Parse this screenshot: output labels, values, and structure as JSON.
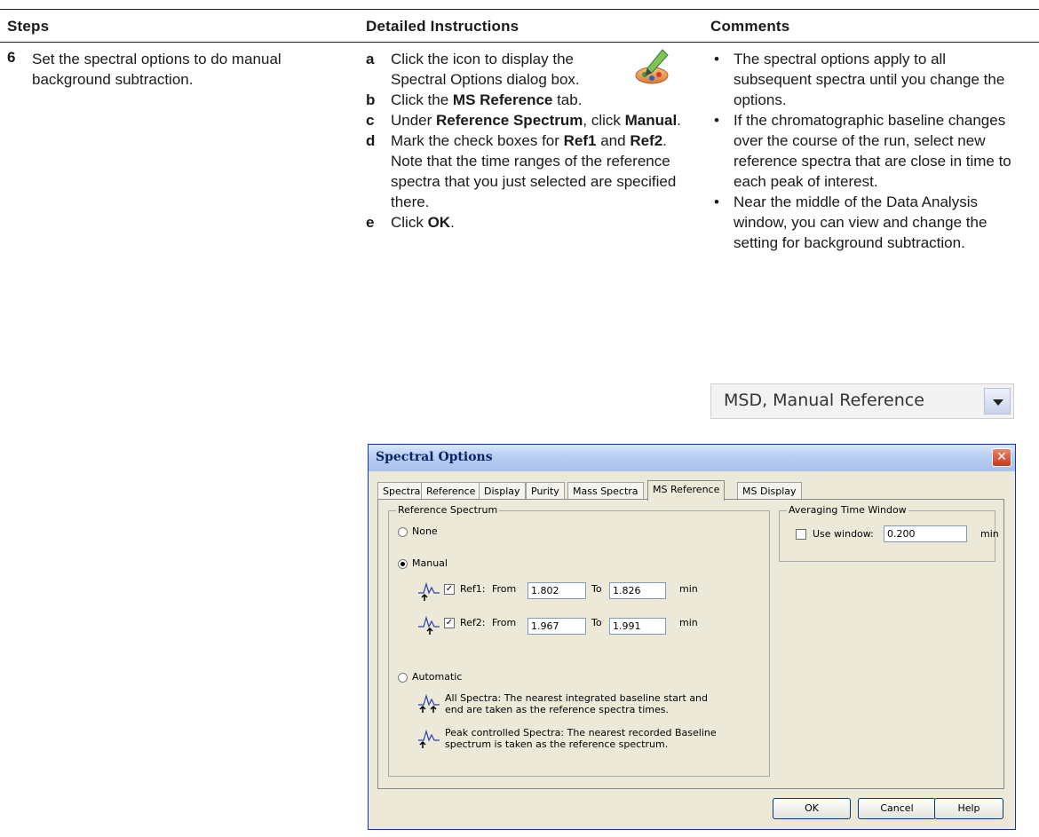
{
  "header": {
    "steps": "Steps",
    "instructions": "Detailed Instructions",
    "comments": "Comments"
  },
  "step": {
    "number": "6",
    "text": "Set the spectral options to do manual background subtraction."
  },
  "instructions": {
    "a": {
      "letter": "a",
      "text": "Click the icon to display the Spectral Options dialog box."
    },
    "b": {
      "letter": "b",
      "pre": "Click the ",
      "bold": "MS Reference",
      "post": " tab."
    },
    "c": {
      "letter": "c",
      "pre": "Under ",
      "bold": "Reference Spectrum",
      "mid": ", click ",
      "bold2": "Manual",
      "post": "."
    },
    "d": {
      "letter": "d",
      "pre": "Mark the check boxes for ",
      "bold": "Ref1",
      "mid": " and ",
      "bold2": "Ref2",
      "post": ". Note that the time ranges of the reference spectra that you just selected are specified there."
    },
    "e": {
      "letter": "e",
      "pre": "Click ",
      "bold": "OK",
      "post": "."
    }
  },
  "comments": [
    "The spectral options apply to all subsequent spectra until you change the options.",
    "If the chromatographic baseline changes over the course of the run, select new reference spectra that are close in time to each peak of interest.",
    "Near the middle of the Data Analysis window, you can view and change the setting for background subtraction."
  ],
  "combo": {
    "value": "MSD, Manual Reference",
    "icon": "dropdown-arrow-icon"
  },
  "dialog": {
    "title": "Spectral Options",
    "tabs": [
      "Spectra",
      "Reference",
      "Display",
      "Purity",
      "Mass Spectra",
      "MS Reference",
      "MS Display"
    ],
    "active_tab": "MS Reference",
    "reference_group": "Reference Spectrum",
    "none_label": "None",
    "manual_label": "Manual",
    "selected_option": "Manual",
    "ref1": {
      "label": "Ref1:",
      "from_label": "From",
      "from": "1.802",
      "to_label": "To",
      "to": "1.826",
      "unit": "min",
      "checked": true
    },
    "ref2": {
      "label": "Ref2:",
      "from_label": "From",
      "from": "1.967",
      "to_label": "To",
      "to": "1.991",
      "unit": "min",
      "checked": true
    },
    "automatic_label": "Automatic",
    "all_spectra_line1": "All Spectra: The nearest integrated baseline start and",
    "all_spectra_line2": "end are taken as the reference spectra times.",
    "peak_line1": "Peak controlled Spectra: The nearest recorded Baseline",
    "peak_line2": "spectrum is taken as the reference spectrum.",
    "averaging_group": "Averaging Time Window",
    "use_window_label": "Use window:",
    "use_window_value": "0.200",
    "use_window_unit": "min",
    "use_window_checked": false,
    "ok": "OK",
    "cancel": "Cancel",
    "help": "Help"
  }
}
